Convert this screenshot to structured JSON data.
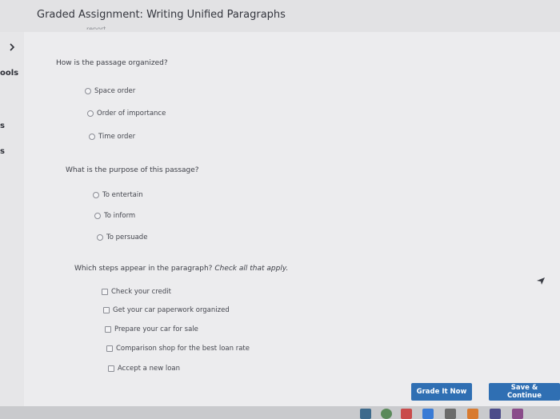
{
  "header": {
    "title": "Graded Assignment: Writing Unified Paragraphs"
  },
  "sidebar": {
    "labels": [
      "ools",
      "s",
      "s"
    ]
  },
  "truncated_word": "report",
  "questions": [
    {
      "text": "How is the passage organized?",
      "type": "radio",
      "options": [
        "Space order",
        "Order of importance",
        "Time order"
      ]
    },
    {
      "text": "What is the purpose of this passage?",
      "type": "radio",
      "options": [
        "To entertain",
        "To inform",
        "To persuade"
      ]
    },
    {
      "text": "Which steps appear in the paragraph?",
      "hint": "Check all that apply.",
      "type": "checkbox",
      "options": [
        "Check your credit",
        "Get your car paperwork organized",
        "Prepare your car for sale",
        "Comparison shop for the best loan rate",
        "Accept a new loan"
      ]
    }
  ],
  "buttons": {
    "grade": "Grade It Now",
    "save": "Save & Continue"
  },
  "colors": {
    "accent": "#2f6fb3",
    "background": "#ececee"
  }
}
